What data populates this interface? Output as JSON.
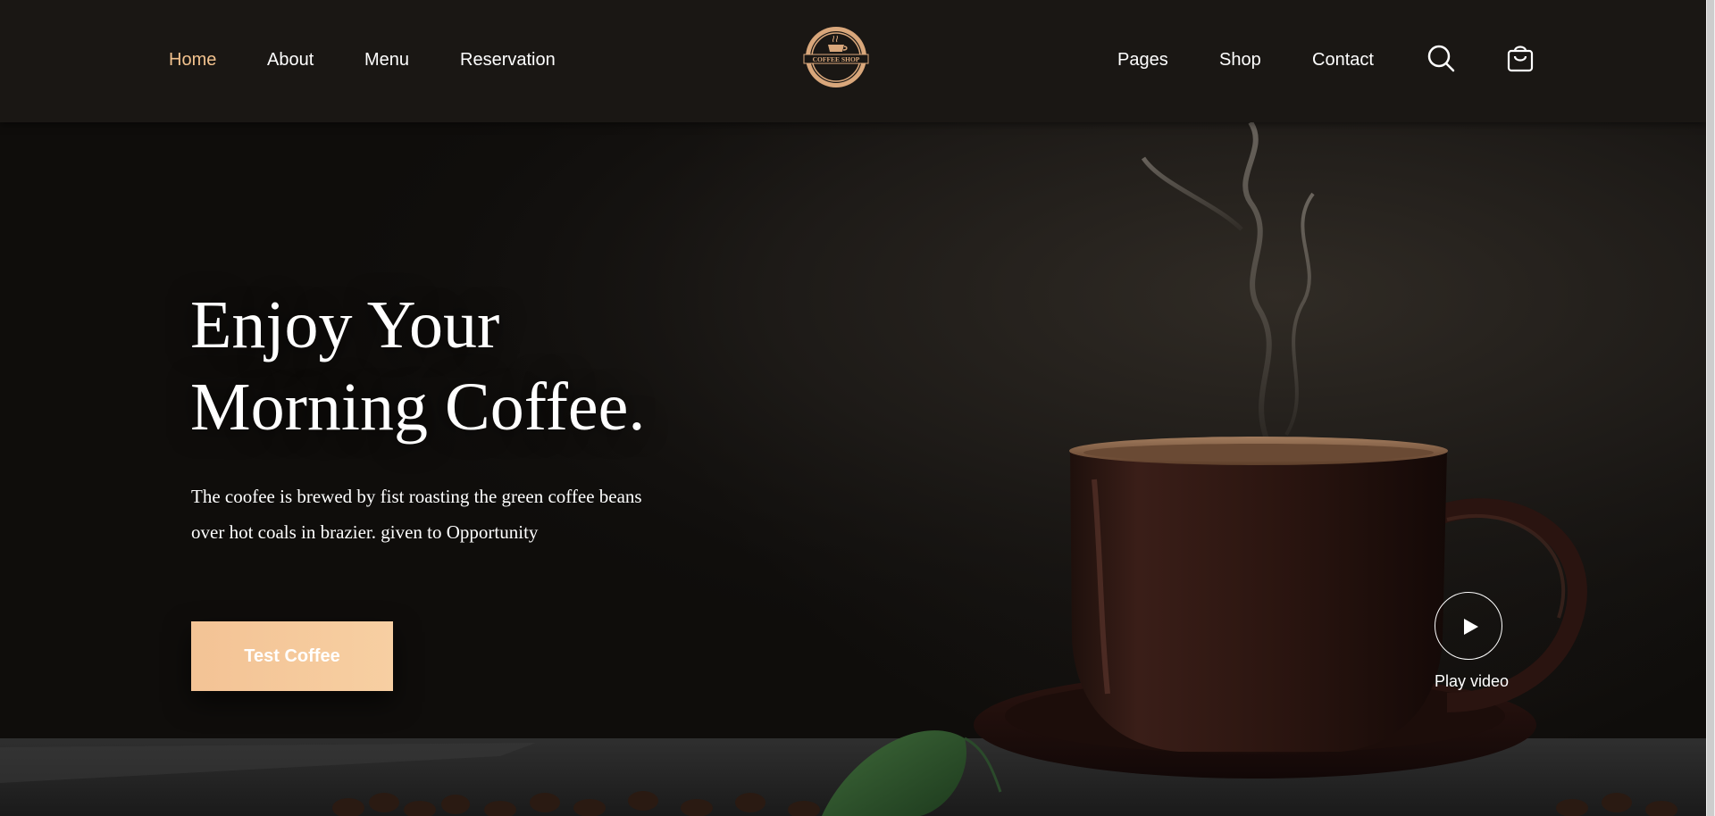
{
  "nav": {
    "left_links": [
      "Home",
      "About",
      "Menu",
      "Reservation"
    ],
    "right_links": [
      "Pages",
      "Shop",
      "Contact"
    ],
    "active": "Home",
    "logo_text": "COFFEE SHOP",
    "icons": [
      "search-icon",
      "cart-icon"
    ]
  },
  "hero": {
    "title_line1": "Enjoy Your",
    "title_line2": "Morning Coffee.",
    "desc_line1": "The coofee is brewed by fist roasting the green coffee beans",
    "desc_line2": "over hot coals in brazier. given to Opportunity",
    "cta_label": "Test Coffee",
    "play_label": "Play video"
  },
  "colors": {
    "accent": "#f2c28e",
    "button": "#f3c395",
    "background": "#0e0c0a",
    "navbar": "#1a1714"
  }
}
